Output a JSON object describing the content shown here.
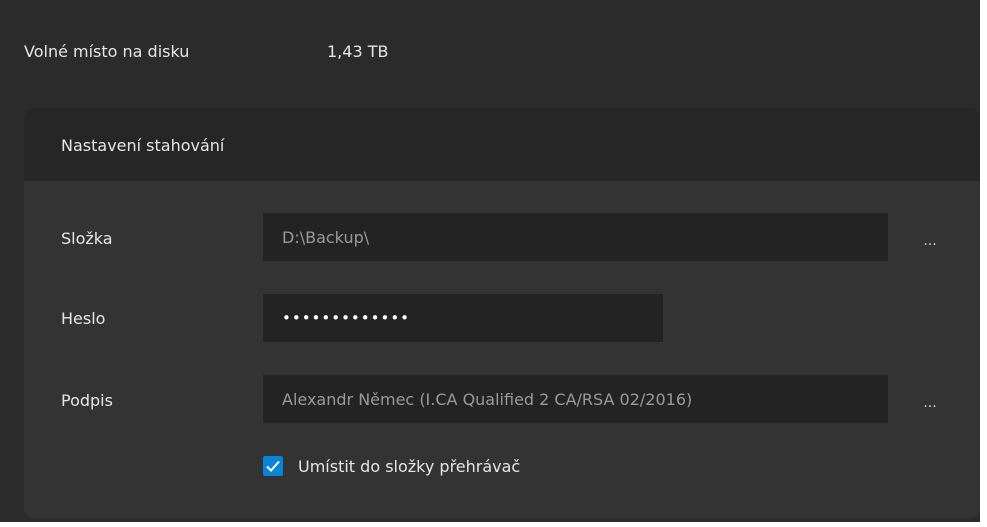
{
  "disk": {
    "label": "Volné místo na disku",
    "value": "1,43 TB"
  },
  "download_settings": {
    "title": "Nastavení stahování",
    "folder": {
      "label": "Složka",
      "value": "D:\\Backup\\",
      "browse_label": "..."
    },
    "password": {
      "label": "Heslo",
      "value": "•••••••••••••"
    },
    "signature": {
      "label": "Podpis",
      "value": "Alexandr Němec (I.CA Qualified 2 CA/RSA 02/2016)",
      "browse_label": "..."
    },
    "player_checkbox": {
      "label": "Umístit do složky přehrávač",
      "checked": true
    }
  },
  "colors": {
    "background": "#2b2b2b",
    "panel": "#333333",
    "panel_header": "#262626",
    "field": "#232323",
    "accent": "#0a84d8"
  }
}
